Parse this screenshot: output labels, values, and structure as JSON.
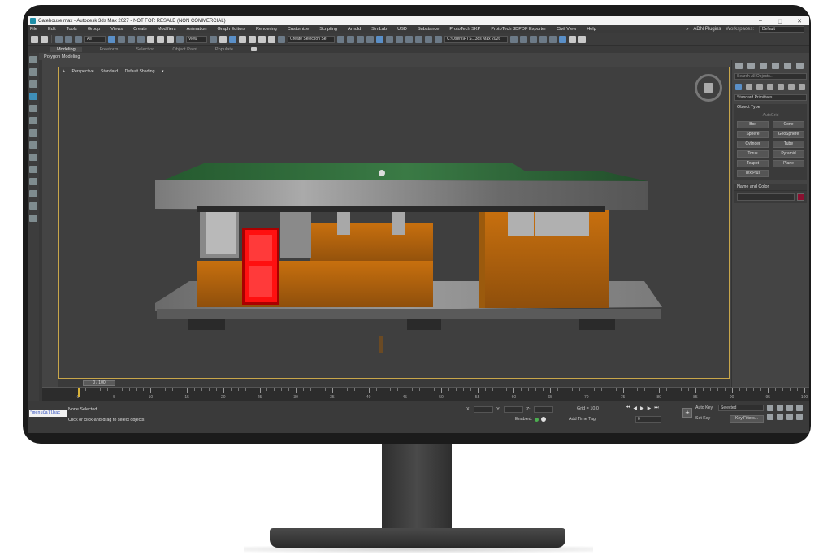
{
  "window": {
    "title": "Gatehouse.max - Autodesk 3ds Max 2027  -  NOT FOR RESALE (NON COMMERCIAL)",
    "minimize": "–",
    "maximize": "◻",
    "close": "✕"
  },
  "menu": {
    "items": [
      "File",
      "Edit",
      "Tools",
      "Group",
      "Views",
      "Create",
      "Modifiers",
      "Animation",
      "Graph Editors",
      "Rendering",
      "Customize",
      "Scripting",
      "Arnold",
      "SimLab",
      "USD",
      "Substance",
      "ProtoTech SKP",
      "ProtoTech 3DPDF Exporter",
      "Civil View",
      "Help"
    ],
    "overflow": "»",
    "user": "ADN Plugins",
    "workspaces_label": "Workspaces:",
    "workspace": "Default"
  },
  "toolbar": {
    "filter": "All",
    "ref_coord": "View",
    "named_selection": "Create Selection Se",
    "project_path": "C:\\Users\\PTS...3ds Max 2026"
  },
  "ribbon": {
    "tabs": [
      "Modeling",
      "Freeform",
      "Selection",
      "Object Paint",
      "Populate"
    ],
    "active_tab": "Modeling",
    "sub_label": "Polygon Modeling"
  },
  "viewport": {
    "label_plus": "+",
    "view": "Perspective",
    "shading_mode": "Standard",
    "shading": "Default Shading",
    "filter_icon": "funnel-icon"
  },
  "command_panel": {
    "search_placeholder": "Search All Objects...",
    "category": "Standard Primitives",
    "object_type_title": "Object Type",
    "autogrid": "AutoGrid",
    "primitives": [
      "Box",
      "Cone",
      "Sphere",
      "GeoSphere",
      "Cylinder",
      "Tube",
      "Torus",
      "Pyramid",
      "Teapot",
      "Plane",
      "TextPlus"
    ],
    "name_color_title": "Name and Color",
    "swatch_color": "#8a1030"
  },
  "timeline": {
    "slider_label": "0 / 100",
    "ticks": [
      "0",
      "5",
      "10",
      "15",
      "20",
      "25",
      "30",
      "35",
      "40",
      "45",
      "50",
      "55",
      "60",
      "65",
      "70",
      "75",
      "80",
      "85",
      "90",
      "95",
      "100"
    ],
    "current_frame": 0
  },
  "status": {
    "maxscript": "\"menuCallbac",
    "selection": "None Selected",
    "prompt": "Click or click-and-drag to select objects",
    "x_label": "X:",
    "y_label": "Y:",
    "z_label": "Z:",
    "grid": "Grid = 10.0",
    "enabled_label": "Enabled:",
    "add_time_tag": "Add Time Tag",
    "frame": "0",
    "auto_key": "Auto Key",
    "set_key": "Set Key",
    "selected": "Selected",
    "key_filters": "Key Filters..."
  },
  "colors": {
    "roof_green": "#2f6a3a",
    "wall_orange": "#b8660e",
    "door_red": "#e00000",
    "active_frame": "#c8a64a"
  }
}
